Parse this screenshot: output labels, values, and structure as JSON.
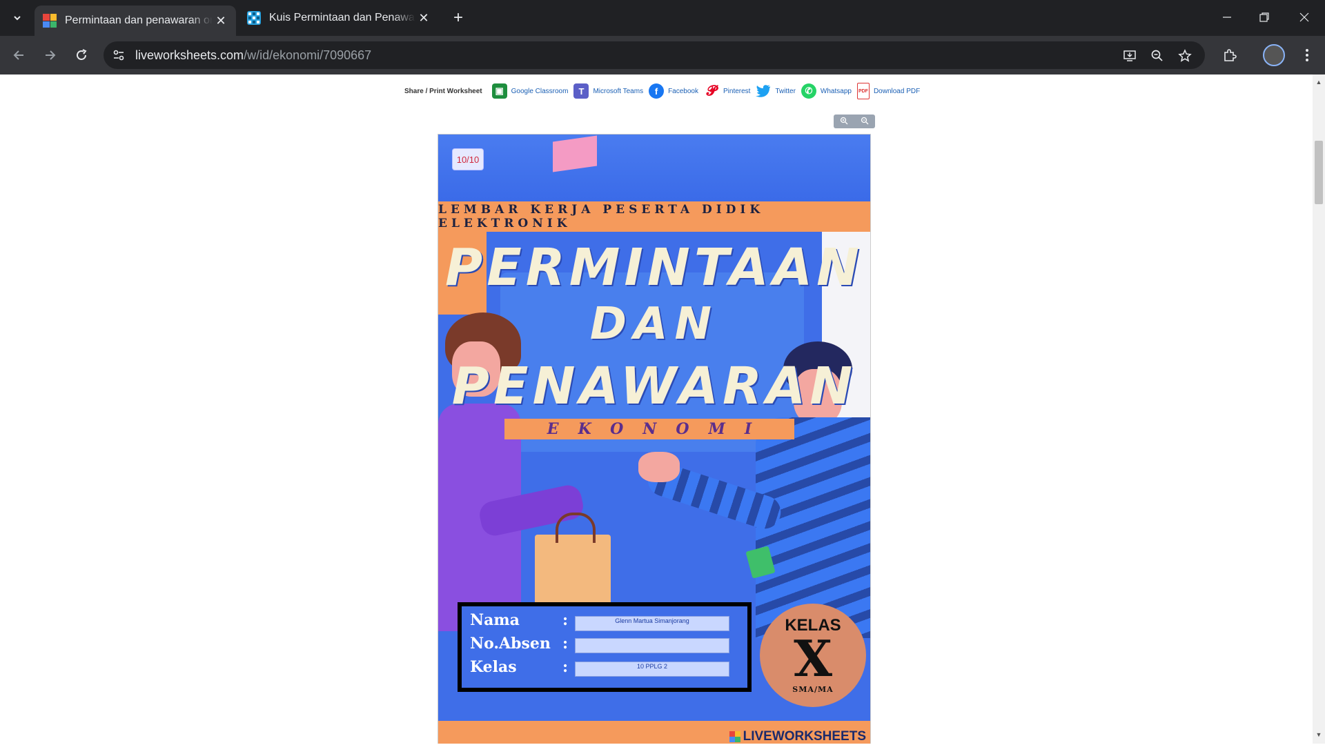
{
  "browser": {
    "tabs": [
      {
        "title": "Permintaan dan penawaran online",
        "active": true
      },
      {
        "title": "Kuis Permintaan dan Penawaran",
        "active": false
      }
    ],
    "url_main": "liveworksheets.com",
    "url_path": "/w/id/ekonomi/7090667"
  },
  "share": {
    "label": "Share / Print Worksheet",
    "items": [
      {
        "label": "Google Classroom",
        "color": "#1e8e3e",
        "icon": "google-classroom-icon"
      },
      {
        "label": "Microsoft Teams",
        "color": "#5b5fc7",
        "icon": "microsoft-teams-icon"
      },
      {
        "label": "Facebook",
        "color": "#1877f2",
        "icon": "facebook-icon"
      },
      {
        "label": "Pinterest",
        "color": "#e60023",
        "icon": "pinterest-icon"
      },
      {
        "label": "Twitter",
        "color": "#1da1f2",
        "icon": "twitter-icon"
      },
      {
        "label": "Whatsapp",
        "color": "#25d366",
        "icon": "whatsapp-icon"
      },
      {
        "label": "Download PDF",
        "color": "#ffffff",
        "icon": "pdf-icon"
      }
    ]
  },
  "worksheet": {
    "score": "10/10",
    "band_title": "LEMBAR KERJA PESERTA DIDIK ELEKTRONIK",
    "title_line1": "PERMINTAAN",
    "title_line2": "DAN",
    "title_line3": "PENAWARAN",
    "subject": "EKONOMI",
    "form": {
      "nama_label": "Nama",
      "absen_label": "No.Absen",
      "kelas_label": "Kelas",
      "colon": ":",
      "nama_value": "Glenn Martua Simanjorang",
      "absen_value": "",
      "kelas_value": "10 PPLG 2"
    },
    "badge": {
      "line1": "KELAS",
      "line2": "X",
      "line3": "SMA/MA"
    },
    "footer_logo": "LIVEWORKSHEETS"
  }
}
